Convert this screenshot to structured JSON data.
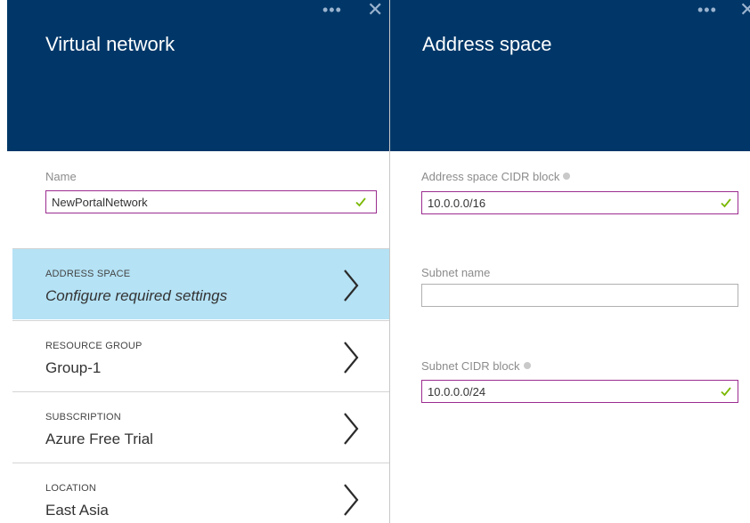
{
  "left_blade": {
    "title": "Virtual network",
    "ellipsis": "•••",
    "close": "✕",
    "name_field": {
      "label": "Name",
      "value": "NewPortalNetwork"
    },
    "rows": [
      {
        "label": "ADDRESS SPACE",
        "value": "Configure required settings"
      },
      {
        "label": "RESOURCE GROUP",
        "value": "Group-1"
      },
      {
        "label": "SUBSCRIPTION",
        "value": "Azure Free Trial"
      },
      {
        "label": "LOCATION",
        "value": "East Asia"
      }
    ]
  },
  "right_blade": {
    "title": "Address space",
    "ellipsis": "•••",
    "close": "✕",
    "cidr_field": {
      "label": "Address space CIDR block",
      "value": "10.0.0.0/16"
    },
    "subnet_name_field": {
      "label": "Subnet name",
      "value": ""
    },
    "subnet_cidr_field": {
      "label": "Subnet CIDR block",
      "value": "10.0.0.0/24"
    }
  },
  "colors": {
    "header_bg": "#003768",
    "active_row_bg": "#b5e2f5",
    "valid_border": "#9b2c8f",
    "check": "#7ab800"
  },
  "icons": [
    "ellipsis-icon",
    "close-icon",
    "check-icon",
    "chevron-right-icon",
    "info-icon"
  ]
}
